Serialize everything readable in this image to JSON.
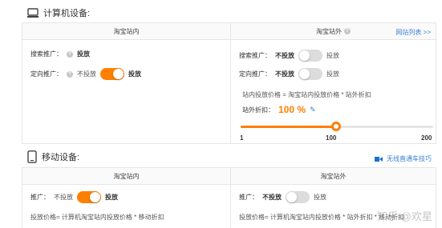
{
  "computer": {
    "title": "计算机设备:",
    "inner_header": "淘宝站内",
    "outer_header": "淘宝站外",
    "site_list_link": "网站列表 >>",
    "inner": {
      "search_label": "搜索推广：",
      "search_value": "投放",
      "target_label": "定向推广：",
      "target_off": "不投放",
      "target_on": "投放",
      "target_enabled": true
    },
    "outer": {
      "search_label": "搜索推广：",
      "search_off": "不投放",
      "search_on": "投放",
      "search_enabled": false,
      "target_label": "定向推广：",
      "target_off": "不投放",
      "target_on": "投放",
      "target_enabled": false,
      "formula": "站内投放价格 = 淘宝站内投放价格 * 站外折扣",
      "discount_label": "站外折扣：",
      "discount_value": "100 %",
      "slider": {
        "min": 1,
        "max": 200,
        "value": 100,
        "ticks": [
          "1",
          "100",
          "200"
        ]
      }
    }
  },
  "mobile": {
    "title": "移动设备:",
    "tips_link": "无线直通车技巧",
    "inner_header": "淘宝站内",
    "outer_header": "淘宝站外",
    "inner": {
      "promo_label": "推广：",
      "off": "不投放",
      "on": "投放",
      "enabled": true,
      "formula": "投放价格= 计算机淘宝站内投放价格 * 移动折扣"
    },
    "outer": {
      "promo_label": "推广：",
      "off": "不投放",
      "on": "投放",
      "enabled": false,
      "formula": "投放价格= 计算机淘宝站内投放价格 * 站外折扣 * 移动折扣"
    }
  },
  "watermark": "知乎 @欢星",
  "colors": {
    "accent": "#ff7f00",
    "link": "#3a7fd5",
    "border": "#e6e6e6"
  },
  "icons": [
    "monitor-icon",
    "phone-icon",
    "help-icon",
    "edit-icon",
    "video-icon"
  ]
}
